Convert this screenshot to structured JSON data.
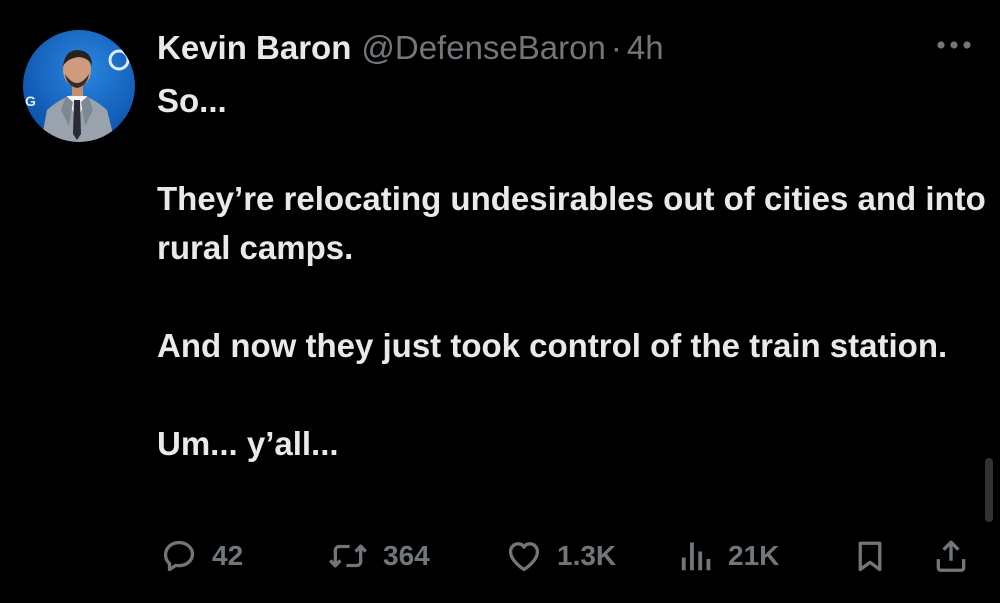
{
  "author": {
    "display_name": "Kevin Baron",
    "handle": "@DefenseBaron",
    "separator": "·",
    "timestamp": "4h"
  },
  "tweet": {
    "paragraphs": [
      "So...",
      "They’re relocating undesirables out of cities and into rural camps.",
      "And now they just took control of the train station.",
      "Um... y’all..."
    ]
  },
  "actions": {
    "reply": {
      "icon": "reply-icon",
      "count": "42"
    },
    "repost": {
      "icon": "repost-icon",
      "count": "364"
    },
    "like": {
      "icon": "like-icon",
      "count": "1.3K"
    },
    "views": {
      "icon": "views-icon",
      "count": "21K"
    },
    "bookmark": {
      "icon": "bookmark-icon"
    },
    "share": {
      "icon": "share-icon"
    }
  },
  "colors": {
    "background": "#000000",
    "primary_text": "#e7e9ea",
    "secondary_text": "#71767b"
  }
}
